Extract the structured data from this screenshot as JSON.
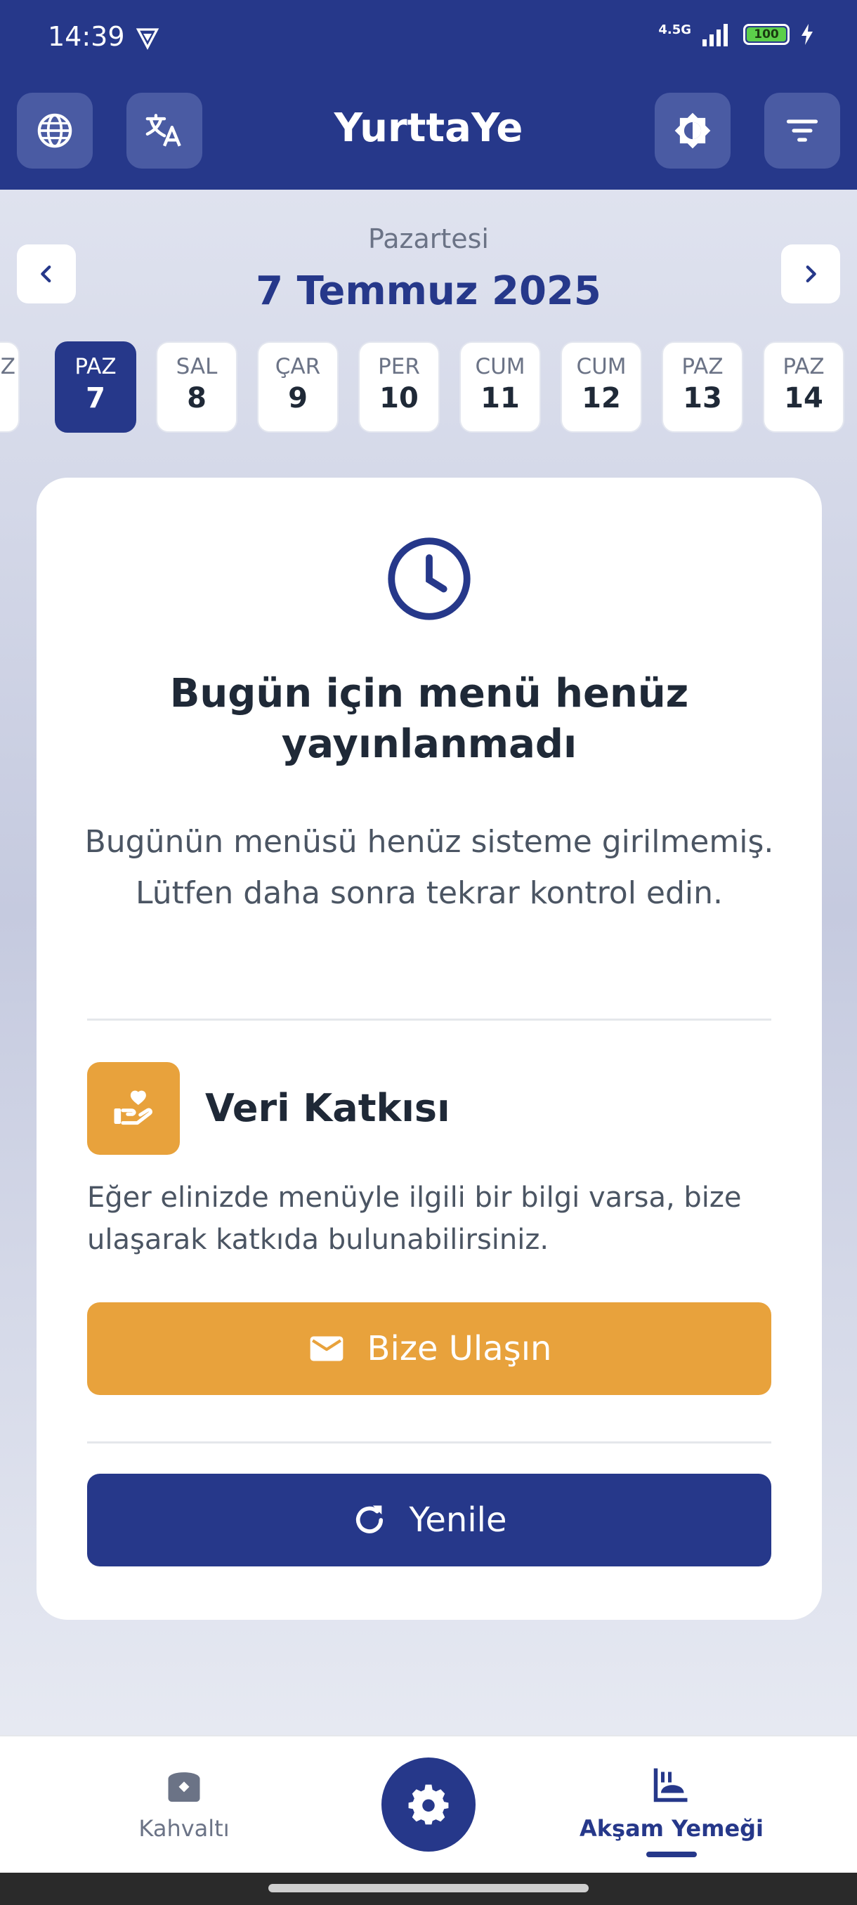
{
  "status_bar": {
    "time": "14:39",
    "network": "4.5G",
    "battery": "100"
  },
  "app_bar": {
    "title": "YurttaYe"
  },
  "date_header": {
    "weekday": "Pazartesi",
    "date": "7 Temmuz 2025"
  },
  "day_strip": {
    "partial_left": "Z",
    "days": [
      {
        "name": "PAZ",
        "num": "7",
        "selected": true
      },
      {
        "name": "SAL",
        "num": "8"
      },
      {
        "name": "ÇAR",
        "num": "9"
      },
      {
        "name": "PER",
        "num": "10"
      },
      {
        "name": "CUM",
        "num": "11"
      },
      {
        "name": "CUM",
        "num": "12"
      },
      {
        "name": "PAZ",
        "num": "13"
      },
      {
        "name": "PAZ",
        "num": "14"
      }
    ]
  },
  "card": {
    "title": "Bugün için menü henüz yayınlanmadı",
    "description": "Bugünün menüsü henüz sisteme girilmemiş. Lütfen daha sonra tekrar kontrol edin.",
    "contribution": {
      "title": "Veri Katkısı",
      "text": "Eğer elinizde menüyle ilgili bir bilgi varsa, bize ulaşarak katkıda bulunabilirsiniz."
    },
    "contact_button": "Bize Ulaşın",
    "refresh_button": "Yenile"
  },
  "bottom_nav": {
    "breakfast": "Kahvaltı",
    "dinner": "Akşam Yemeği",
    "active": "dinner"
  },
  "colors": {
    "primary": "#26388a",
    "accent": "#e8a23c",
    "text": "#1f2937",
    "muted": "#6b7386"
  },
  "icons": [
    "globe-icon",
    "translate-icon",
    "brightness-icon",
    "filter-icon",
    "chevron-left-icon",
    "chevron-right-icon",
    "clock-icon",
    "heart-hand-icon",
    "mail-icon",
    "refresh-icon",
    "breakfast-icon",
    "settings-icon",
    "dinner-icon"
  ]
}
